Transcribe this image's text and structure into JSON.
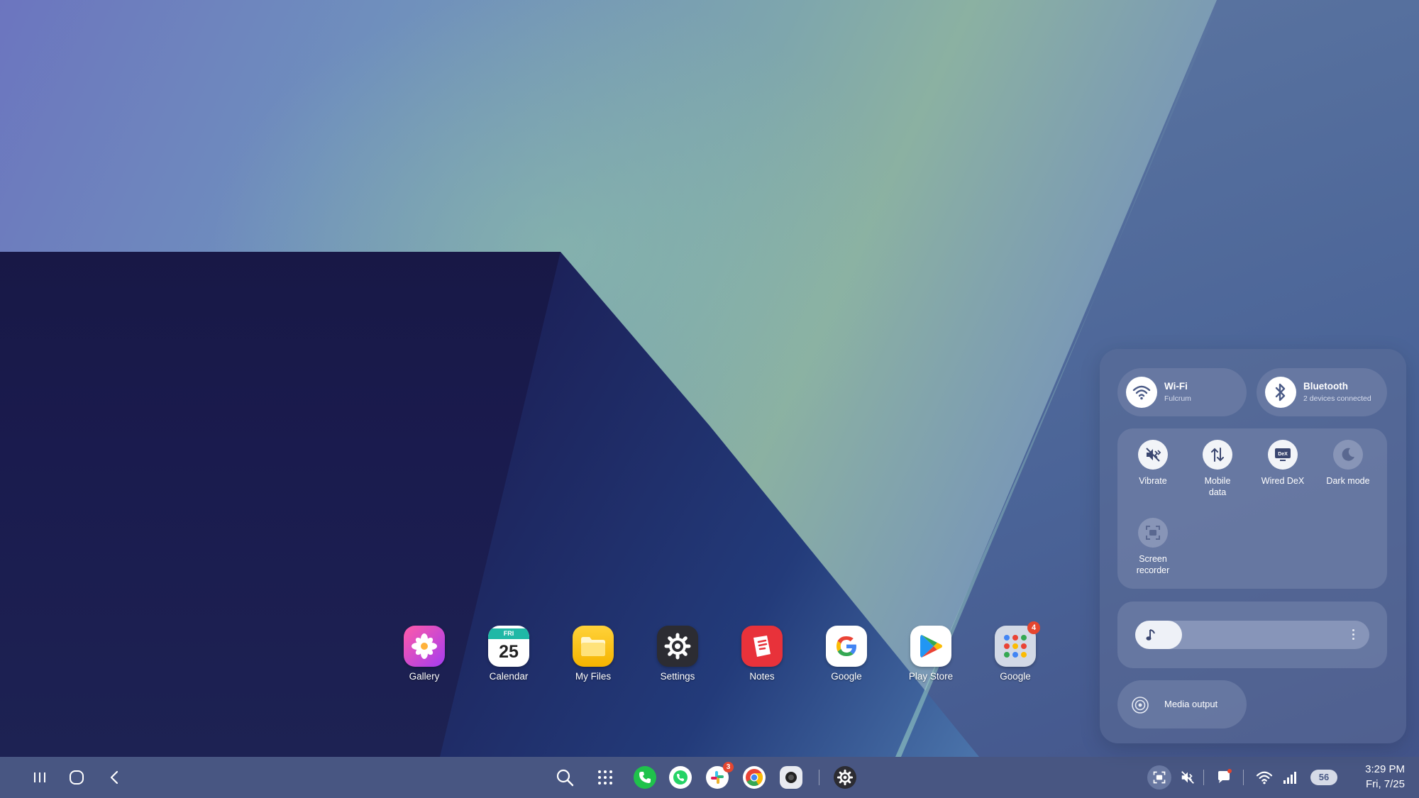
{
  "dock": {
    "apps": [
      {
        "label": "Gallery",
        "icon": "gallery-icon"
      },
      {
        "label": "Calendar",
        "icon": "calendar-icon",
        "day_abbr": "FRI",
        "date": "25"
      },
      {
        "label": "My Files",
        "icon": "folder-icon"
      },
      {
        "label": "Settings",
        "icon": "gear-icon"
      },
      {
        "label": "Notes",
        "icon": "notes-icon"
      },
      {
        "label": "Google",
        "icon": "google-icon"
      },
      {
        "label": "Play Store",
        "icon": "play-store-icon"
      },
      {
        "label": "Google",
        "icon": "google-folder-icon",
        "badge": "4"
      }
    ]
  },
  "quick_panel": {
    "wifi": {
      "label": "Wi-Fi",
      "network": "Fulcrum",
      "icon": "wifi-icon"
    },
    "bluetooth": {
      "label": "Bluetooth",
      "status": "2 devices connected",
      "icon": "bluetooth-icon"
    },
    "toggles": [
      {
        "label": "Vibrate",
        "icon": "vibrate-icon",
        "on": true
      },
      {
        "label": "Mobile data",
        "icon": "mobile-data-icon",
        "on": true
      },
      {
        "label": "Wired DeX",
        "icon": "dex-icon",
        "on": true
      },
      {
        "label": "Dark mode",
        "icon": "moon-icon",
        "on": false
      },
      {
        "label": "Screen recorder",
        "icon": "screen-recorder-icon",
        "on": false
      }
    ],
    "dex_icon_text": "DeX",
    "volume": {
      "icon": "music-note-icon",
      "level": 0.07
    },
    "media_output": {
      "label": "Media output",
      "icon": "media-output-icon"
    }
  },
  "taskbar": {
    "nav": [
      "recents-icon",
      "home-icon",
      "back-icon"
    ],
    "center": [
      "search-icon",
      "apps-grid-icon",
      "phone-icon",
      "whatsapp-icon",
      "slack-icon",
      "chrome-icon",
      "camera-icon",
      "settings-icon"
    ],
    "slack_badge": "3",
    "status": {
      "battery": "56",
      "time": "3:29 PM",
      "date": "Fri, 7/25"
    }
  },
  "colors": {
    "accent": "#3b74f2",
    "badge": "#e5462f",
    "panel": "#6e7da5"
  }
}
